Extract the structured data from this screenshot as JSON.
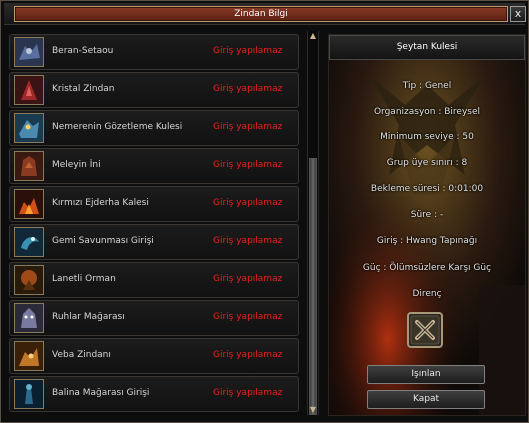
{
  "window": {
    "title": "Zindan Bilgi",
    "close_label": "x"
  },
  "list": {
    "items": [
      {
        "name": "Beran-Setaou",
        "status": "Giriş yapılamaz",
        "icon": "beran-setaou-icon"
      },
      {
        "name": "Kristal Zindan",
        "status": "Giriş yapılamaz",
        "icon": "kristal-zindan-icon"
      },
      {
        "name": "Nemerenin Gözetleme Kulesi",
        "status": "Giriş yapılamaz",
        "icon": "nemere-icon"
      },
      {
        "name": "Meleyin İni",
        "status": "Giriş yapılamaz",
        "icon": "meley-icon"
      },
      {
        "name": "Kırmızı Ejderha Kalesi",
        "status": "Giriş yapılamaz",
        "icon": "red-dragon-icon"
      },
      {
        "name": "Gemi Savunması Girişi",
        "status": "Giriş yapılamaz",
        "icon": "ship-defense-icon"
      },
      {
        "name": "Lanetli Orman",
        "status": "Giriş yapılamaz",
        "icon": "cursed-forest-icon"
      },
      {
        "name": "Ruhlar Mağarası",
        "status": "Giriş yapılamaz",
        "icon": "spirit-cave-icon"
      },
      {
        "name": "Veba Zindanı",
        "status": "Giriş yapılamaz",
        "icon": "plague-dungeon-icon"
      },
      {
        "name": "Balina Mağarası Girişi",
        "status": "Giriş yapılamaz",
        "icon": "whale-cave-icon"
      }
    ]
  },
  "detail": {
    "title": "Şeytan Kulesi",
    "tip": "Tip : Genel",
    "organization": "Organizasyon : Bireysel",
    "min_level": "Minimum seviye : 50",
    "group_limit": "Grup üye sınırı : 8",
    "cooldown": "Bekleme süresi : 0:01:00",
    "duration": "Süre :  -",
    "entrance": "Giriş : Hwang Tapınağı",
    "power": "Güç : Ölümsüzlere Karşı Güç",
    "resistance": "Direnç",
    "teleport_label": "Işınlan",
    "close_label": "Kapat"
  },
  "colors": {
    "status_red": "#e82020",
    "title_plate": "#8a3a26",
    "frame_gold": "#c0986a"
  }
}
